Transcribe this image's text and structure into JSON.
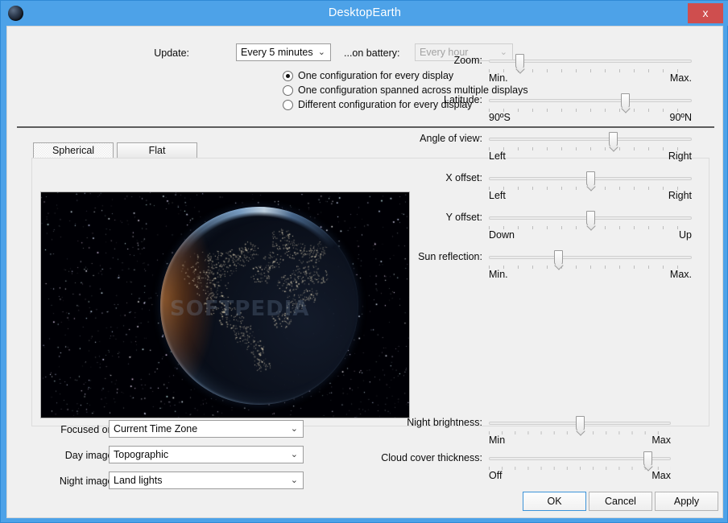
{
  "window": {
    "title": "DesktopEarth",
    "app_icon": "globe-icon",
    "close_label": "x",
    "titlebar_color": "#4da2e8",
    "accent_color": "#3d93d8"
  },
  "top": {
    "update_label": "Update:",
    "update_value": "Every 5 minutes",
    "battery_label": "...on battery:",
    "battery_value": "Every hour",
    "battery_disabled": true,
    "dropdown_arrow": "⌄"
  },
  "display_mode": {
    "options": [
      {
        "label": "One configuration for every display",
        "selected": true
      },
      {
        "label": "One configuration spanned across multiple displays",
        "selected": false
      },
      {
        "label": "Different configuration for every display",
        "selected": false
      }
    ]
  },
  "tabs": [
    {
      "label": "Spherical",
      "active": true
    },
    {
      "label": "Flat",
      "active": false
    }
  ],
  "preview": {
    "watermark": "SOFTPEDIA",
    "description": "Earth globe rendered at night over a starfield"
  },
  "sliders": [
    {
      "label": "Zoom:",
      "low": "Min.",
      "high": "Max.",
      "value_pct": 15
    },
    {
      "label": "Latitude:",
      "low": "90ºS",
      "high": "90ºN",
      "value_pct": 67
    },
    {
      "label": "Angle of view:",
      "low": "Left",
      "high": "Right",
      "value_pct": 61
    },
    {
      "label": "X offset:",
      "low": "Left",
      "high": "Right",
      "value_pct": 50
    },
    {
      "label": "Y offset:",
      "low": "Down",
      "high": "Up",
      "value_pct": 50
    },
    {
      "label": "Sun reflection:",
      "low": "Min.",
      "high": "Max.",
      "value_pct": 34
    }
  ],
  "bottom_sliders": [
    {
      "label": "Night brightness:",
      "low": "Min",
      "high": "Max",
      "value_pct": 50
    },
    {
      "label": "Cloud cover thickness:",
      "low": "Off",
      "high": "Max",
      "value_pct": 87
    }
  ],
  "image_options": [
    {
      "label": "Focused on:",
      "value": "Current Time Zone"
    },
    {
      "label": "Day image:",
      "value": "Topographic"
    },
    {
      "label": "Night image:",
      "value": "Land lights"
    }
  ],
  "buttons": {
    "ok": "OK",
    "cancel": "Cancel",
    "apply": "Apply"
  }
}
